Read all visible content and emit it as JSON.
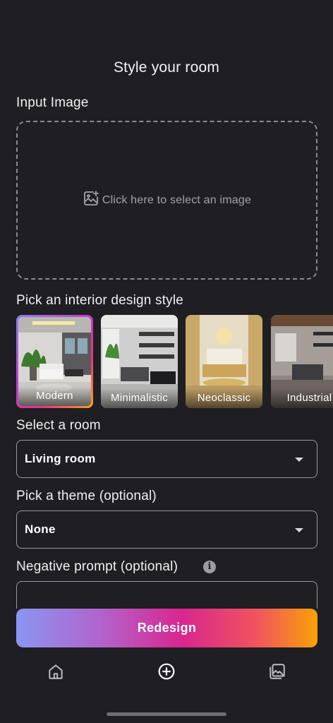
{
  "header": {
    "title": "Style your room"
  },
  "input_image": {
    "label": "Input Image",
    "placeholder": "Click here to select an image",
    "icon": "add-photo-icon"
  },
  "styles": {
    "label": "Pick an interior design style",
    "selected": "Modern",
    "items": [
      {
        "label": "Modern"
      },
      {
        "label": "Minimalistic"
      },
      {
        "label": "Neoclassic"
      },
      {
        "label": "Industrial"
      }
    ]
  },
  "room": {
    "label": "Select a room",
    "value": "Living room"
  },
  "theme": {
    "label": "Pick a theme (optional)",
    "value": "None"
  },
  "negative_prompt": {
    "label": "Negative prompt (optional)",
    "info_icon": "info-icon",
    "value": ""
  },
  "action": {
    "redesign_label": "Redesign"
  },
  "bottom_nav": {
    "items": [
      {
        "icon": "home-icon"
      },
      {
        "icon": "add-circle-icon",
        "active": true
      },
      {
        "icon": "gallery-icon"
      }
    ]
  },
  "colors": {
    "background": "#1f1e22",
    "gradient_start": "#8b95f2",
    "gradient_mid": "#d9268f",
    "gradient_end": "#fba108"
  }
}
